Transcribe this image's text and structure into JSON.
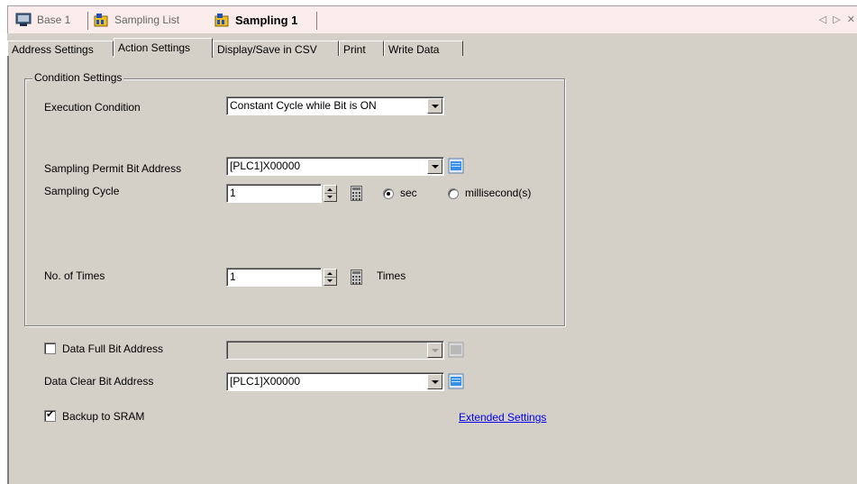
{
  "doc_tabs": [
    {
      "label": "Base 1",
      "icon": "screen-icon",
      "active": false
    },
    {
      "label": "Sampling List",
      "icon": "sampling-list-icon",
      "active": false
    },
    {
      "label": "Sampling 1",
      "icon": "sampling-icon",
      "active": true
    }
  ],
  "doc_tab_scroll": "◁ ▷ ✕",
  "prop_tabs": [
    {
      "label": "Address Settings"
    },
    {
      "label": "Action Settings"
    },
    {
      "label": "Display/Save in CSV"
    },
    {
      "label": "Print"
    },
    {
      "label": "Write Data"
    }
  ],
  "active_prop_tab": "Action Settings",
  "condition_settings": {
    "title": "Condition Settings",
    "execution_condition": {
      "label": "Execution Condition",
      "value": "Constant Cycle while Bit is ON"
    },
    "permit_bit": {
      "label": "Sampling Permit Bit Address",
      "value": "[PLC1]X00000"
    },
    "sampling_cycle": {
      "label": "Sampling Cycle",
      "value": "1",
      "unit_sec": "sec",
      "unit_ms": "millisecond(s)",
      "selected_unit": "sec"
    },
    "times": {
      "label": "No. of Times",
      "value": "1",
      "unit": "Times"
    }
  },
  "data_full": {
    "label": "Data Full Bit Address",
    "checked": false,
    "value": ""
  },
  "data_clear": {
    "label": "Data Clear Bit Address",
    "value": "[PLC1]X00000"
  },
  "backup": {
    "label": "Backup to SRAM",
    "checked": true
  },
  "extended_link": "Extended Settings",
  "colors": {
    "panel": "#d4d0c8",
    "tab_band": "#fbecec",
    "link": "#0000ee"
  }
}
